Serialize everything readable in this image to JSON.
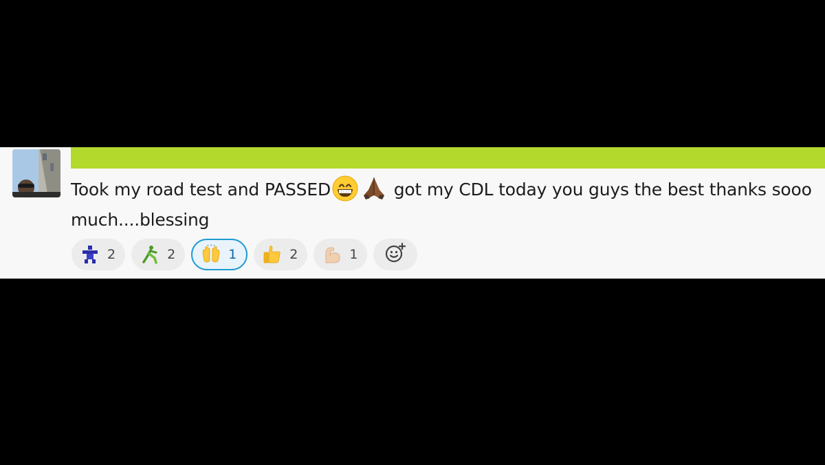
{
  "message": {
    "text_part1": "Took my road test and PASSED",
    "text_part2": " got my CDL today you guys the best thanks sooo much....blessing",
    "inline_emojis": [
      "grinning-face",
      "folded-hands-dark-skin"
    ]
  },
  "reactions": [
    {
      "icon": "custom-blue-figure",
      "count": "2",
      "active": false
    },
    {
      "icon": "custom-green-runner",
      "count": "2",
      "active": false
    },
    {
      "icon": "raising-hands",
      "count": "1",
      "active": true
    },
    {
      "icon": "thumbs-up",
      "count": "2",
      "active": false
    },
    {
      "icon": "flexed-biceps-light-skin",
      "count": "1",
      "active": false
    }
  ],
  "add_reaction": {
    "icon": "add-reaction-icon"
  },
  "colors": {
    "highlight": "#b2d92b",
    "active_reaction_border": "#1d9bd1",
    "text": "#1d1c1d"
  }
}
